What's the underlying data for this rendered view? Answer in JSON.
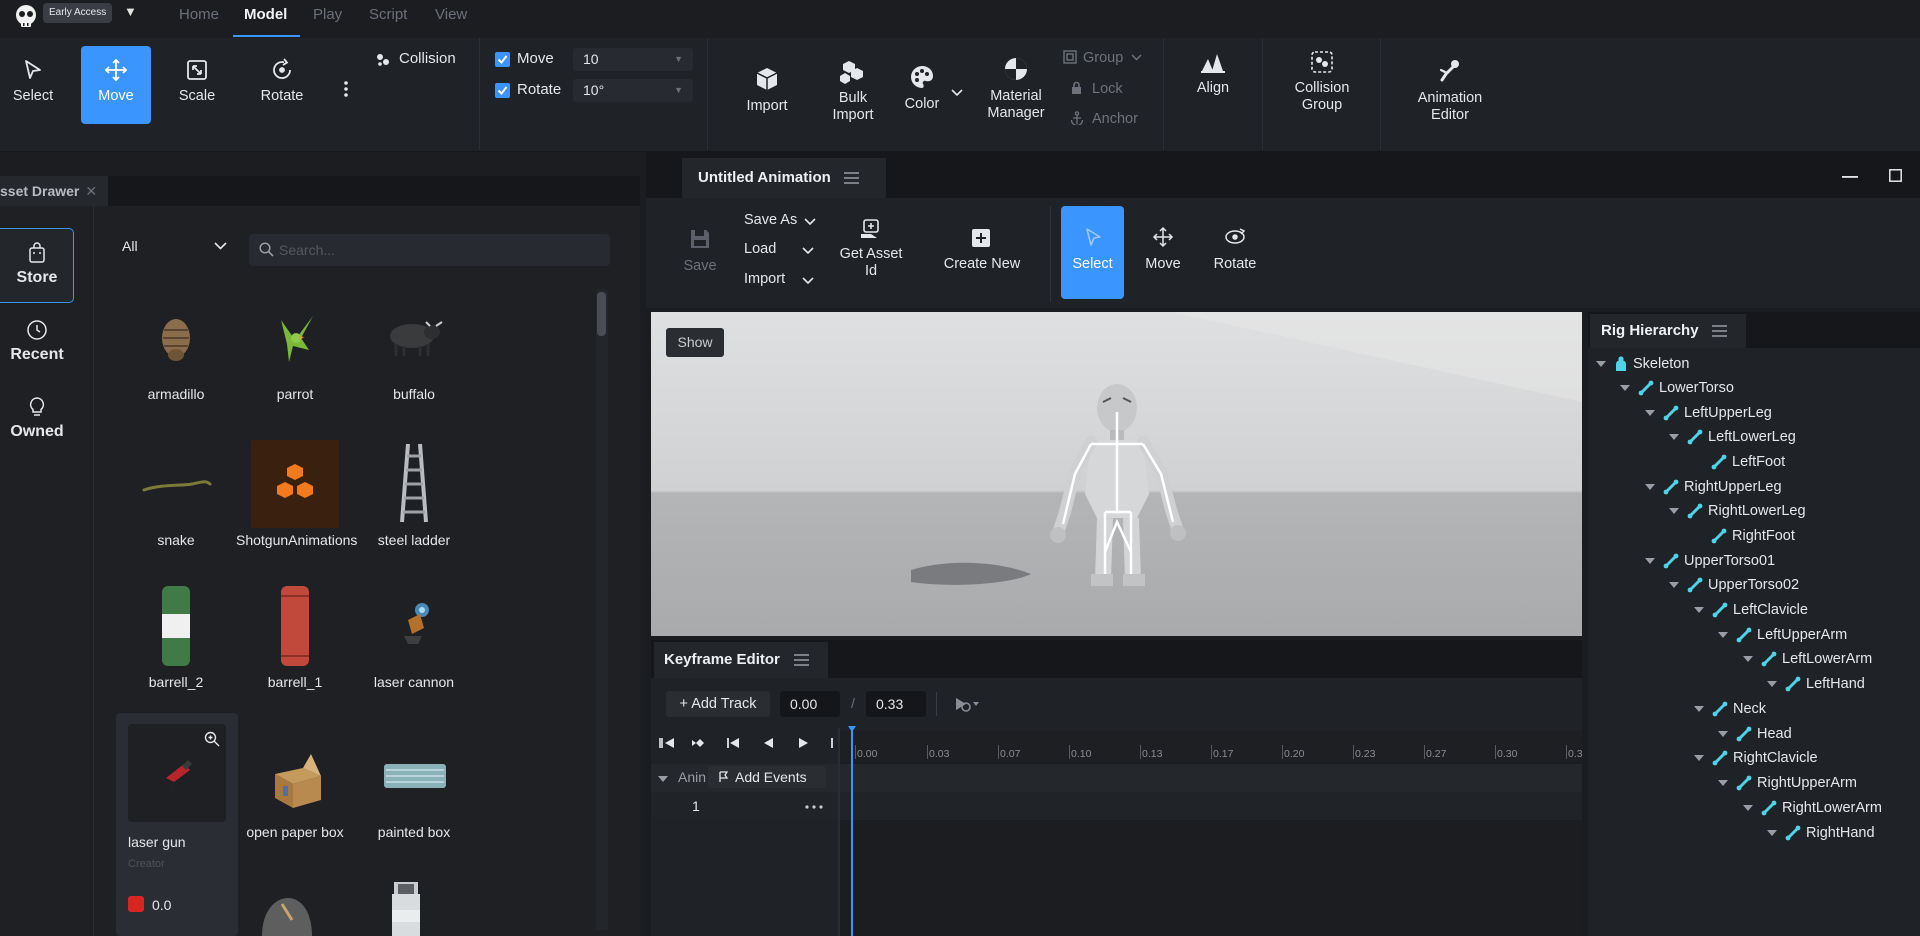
{
  "topbar": {
    "badge": "Early Access",
    "badge_caret": "▼",
    "menu": [
      "Home",
      "Model",
      "Play",
      "Script",
      "View"
    ],
    "active_menu": "Model"
  },
  "toolbar": {
    "select": "Select",
    "move": "Move",
    "scale": "Scale",
    "rotate": "Rotate",
    "collision": "Collision",
    "snap_move_label": "Move",
    "snap_move_value": "10",
    "snap_rotate_label": "Rotate",
    "snap_rotate_value": "10°",
    "import": "Import",
    "bulk_import": "Bulk Import",
    "color": "Color",
    "material_manager": "Material Manager",
    "group": "Group",
    "lock": "Lock",
    "anchor": "Anchor",
    "align": "Align",
    "collision_group": "Collision Group",
    "animation_editor": "Animation Editor"
  },
  "asset_drawer": {
    "tab": "sset Drawer",
    "nav": [
      "Store",
      "Recent",
      "Owned"
    ],
    "filter": "All",
    "search_placeholder": "Search...",
    "items": [
      "armadillo",
      "parrot",
      "buffalo",
      "snake",
      "ShotgunAnimations",
      "steel ladder",
      "barrell_2",
      "barrell_1",
      "laser cannon",
      "laser gun",
      "open paper box",
      "painted box"
    ],
    "card_creator": "Creator",
    "card_price": "0.0"
  },
  "animation": {
    "tab": "Untitled Animation",
    "save": "Save",
    "save_as": "Save As",
    "load": "Load",
    "import": "Import",
    "get_asset_id": "Get Asset Id",
    "create_new": "Create New",
    "select": "Select",
    "move": "Move",
    "rotate": "Rotate",
    "show": "Show"
  },
  "keyframe": {
    "tab": "Keyframe Editor",
    "add_track": "+ Add Track",
    "time_current": "0.00",
    "time_sep": "/",
    "time_total": "0.33",
    "ticks": [
      "0.00",
      "0.03",
      "0.07",
      "0.10",
      "0.13",
      "0.17",
      "0.20",
      "0.23",
      "0.27",
      "0.30",
      "0.3"
    ],
    "row_label": "Anin",
    "add_events": "Add Events",
    "row_index": "1"
  },
  "rig": {
    "tab": "Rig Hierarchy",
    "nodes": [
      "Skeleton",
      "LowerTorso",
      "LeftUpperLeg",
      "LeftLowerLeg",
      "LeftFoot",
      "RightUpperLeg",
      "RightLowerLeg",
      "RightFoot",
      "UpperTorso01",
      "UpperTorso02",
      "LeftClavicle",
      "LeftUpperArm",
      "LeftLowerArm",
      "LeftHand",
      "Neck",
      "Head",
      "RightClavicle",
      "RightUpperArm",
      "RightLowerArm",
      "RightHand"
    ]
  },
  "colors": {
    "accent": "#3b95ff",
    "bone": "#4fd3e8",
    "background": "#1b1d21",
    "panel": "#1f2226"
  }
}
